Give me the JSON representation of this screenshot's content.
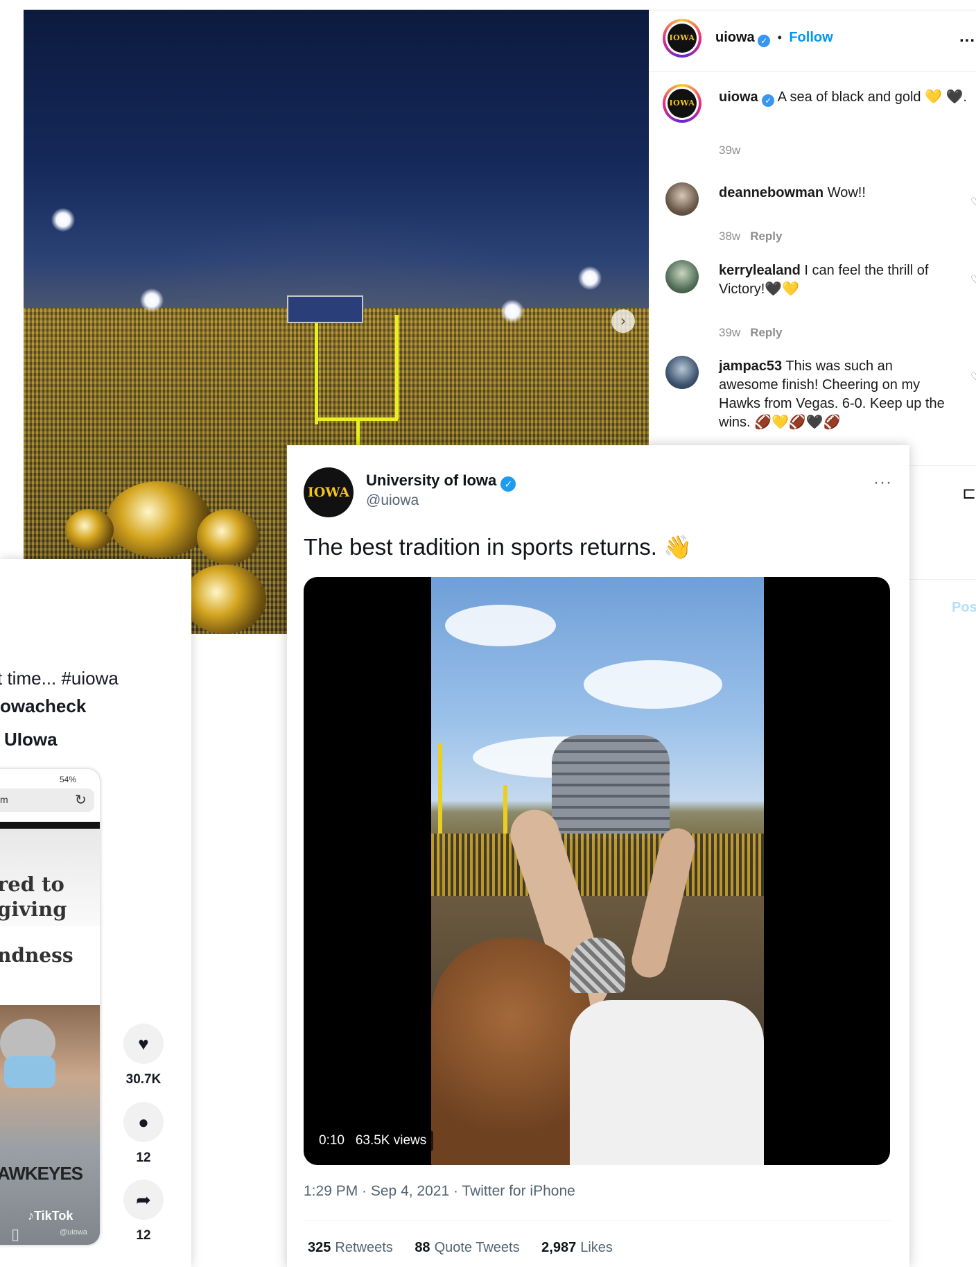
{
  "instagram": {
    "header": {
      "username": "uiowa",
      "separator": "•",
      "follow_label": "Follow",
      "more_label": "...",
      "avatar_text": "IOWA"
    },
    "caption": {
      "username": "uiowa",
      "text": "A sea of black and gold 💛 🖤.",
      "age": "39w"
    },
    "comments": [
      {
        "username": "deannebowman",
        "text": "Wow!!",
        "age": "38w",
        "reply_label": "Reply"
      },
      {
        "username": "kerrylealand",
        "text": "I can feel the thrill of Victory!🖤💛",
        "age": "39w",
        "reply_label": "Reply"
      },
      {
        "username": "jampac53",
        "text": "This was such an awesome finish! Cheering on my Hawks from Vegas. 6-0. Keep up the wins. 🏈💛🏈🖤🏈"
      }
    ],
    "post_label": "Pos",
    "bookmark_icon": "bookmark-icon"
  },
  "tiktok": {
    "caption_lines": [
      "t time... #uiowa",
      "owacheck",
      "UIowa"
    ],
    "phone": {
      "status": "54%",
      "url_fragment": "m",
      "headline": [
        "red to",
        "giving",
        "ndness"
      ],
      "shirt_text": "AWKEYES",
      "watermark": "TikTok",
      "watermark_handle": "@uiowa"
    },
    "actions": [
      {
        "icon": "heart-icon",
        "count": "30.7K"
      },
      {
        "icon": "comment-icon",
        "count": "12"
      },
      {
        "icon": "share-icon",
        "count": "12"
      }
    ]
  },
  "tweet": {
    "name": "University of Iowa",
    "handle": "@uiowa",
    "more_label": "···",
    "avatar_text": "IOWA",
    "text": "The best tradition in sports returns. 👋",
    "video_duration": "0:10",
    "video_views": "63.5K views",
    "meta": "1:29 PM · Sep 4, 2021 · Twitter for iPhone",
    "stats": [
      {
        "value": "325",
        "label": "Retweets"
      },
      {
        "value": "88",
        "label": "Quote Tweets"
      },
      {
        "value": "2,987",
        "label": "Likes"
      }
    ]
  },
  "colors": {
    "iowa_gold": "#f5c31a",
    "instagram_blue": "#0095f6",
    "twitter_verified": "#1d9bf0"
  }
}
